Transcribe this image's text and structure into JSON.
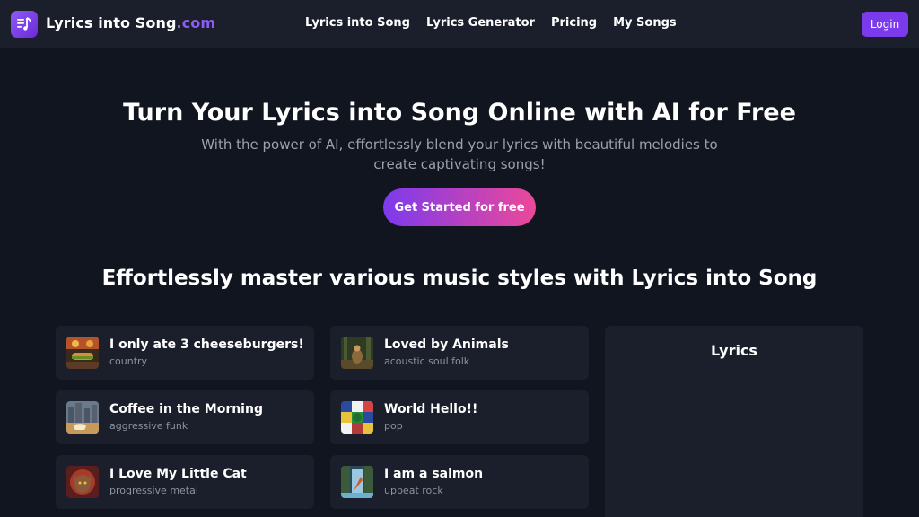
{
  "header": {
    "brand_main": "Lyrics into Song",
    "brand_domain": ".com",
    "nav": [
      "Lyrics into Song",
      "Lyrics Generator",
      "Pricing",
      "My Songs"
    ],
    "login_label": "Login"
  },
  "hero": {
    "title": "Turn Your Lyrics into Song Online with AI for Free",
    "subtitle": "With the power of AI, effortlessly blend your lyrics with beautiful melodies to create captivating songs!",
    "cta_label": "Get Started for free"
  },
  "styles_section": {
    "title": "Effortlessly master various music styles with Lyrics into Song"
  },
  "songs": [
    {
      "title": "I only ate 3 cheeseburgers!",
      "style": "country"
    },
    {
      "title": "Loved by Animals",
      "style": "acoustic soul folk"
    },
    {
      "title": "Coffee in the Morning",
      "style": "aggressive funk"
    },
    {
      "title": "World Hello!!",
      "style": "pop"
    },
    {
      "title": "I Love My Little Cat",
      "style": "progressive metal"
    },
    {
      "title": "I am a salmon",
      "style": "upbeat rock"
    }
  ],
  "lyrics_panel": {
    "title": "Lyrics"
  },
  "colors": {
    "background": "#111520",
    "card": "#1a1f2b",
    "accent": "#7c3aed",
    "brand_domain": "#8b5cf6",
    "cta_gradient_end": "#ec4899"
  },
  "icons": {
    "logo": "music-lyrics-icon"
  }
}
